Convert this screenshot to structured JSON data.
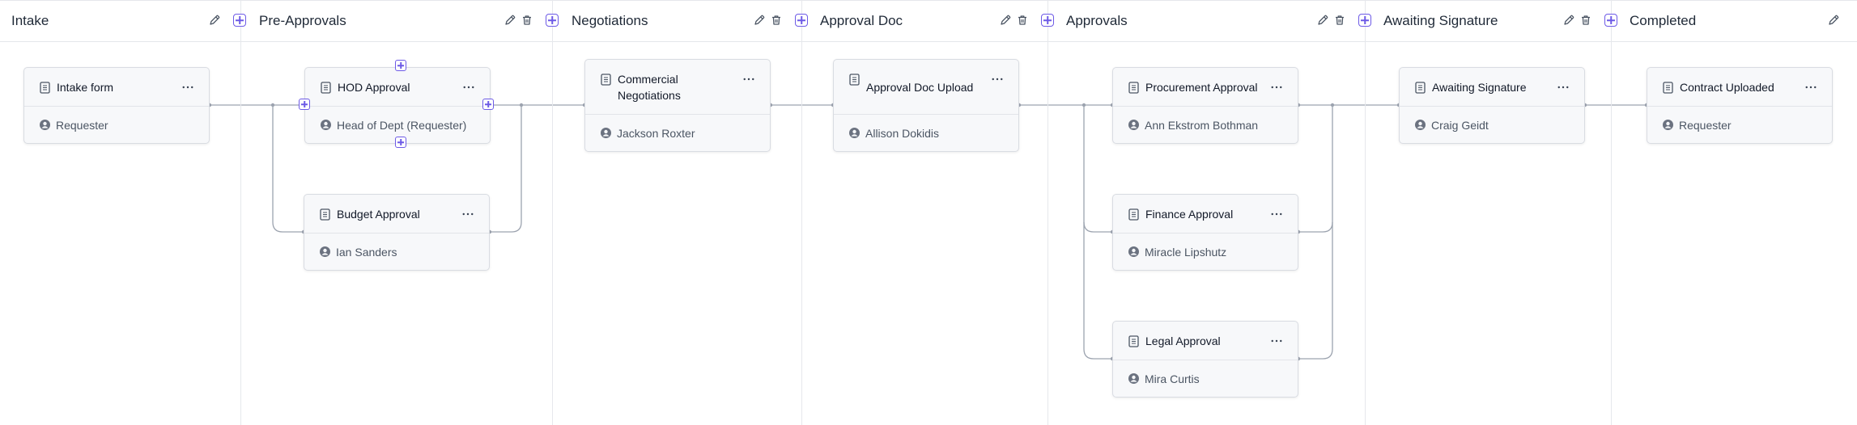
{
  "colors": {
    "accent": "#6d5ae6",
    "edge": "#9ca3af",
    "card_bg": "#f7f8fa",
    "card_border": "#d9dce2",
    "divider": "#e6e8ec"
  },
  "icons": {
    "edit": "pencil-icon",
    "delete": "trash-icon",
    "add": "plus-square-icon",
    "card_type": "document-icon",
    "card_menu": "ellipsis-icon",
    "assignee": "user-circle-icon"
  },
  "columns": [
    {
      "id": "intake",
      "title": "Intake",
      "deletable": false
    },
    {
      "id": "pre-approvals",
      "title": "Pre-Approvals",
      "deletable": true
    },
    {
      "id": "negotiations",
      "title": "Negotiations",
      "deletable": true
    },
    {
      "id": "approval-doc",
      "title": "Approval Doc",
      "deletable": true
    },
    {
      "id": "approvals",
      "title": "Approvals",
      "deletable": true
    },
    {
      "id": "awaiting-signature",
      "title": "Awaiting Signature",
      "deletable": true
    },
    {
      "id": "completed",
      "title": "Completed",
      "deletable": false
    }
  ],
  "cards": [
    {
      "id": "intake-form",
      "column": "intake",
      "title": "Intake form",
      "assignee": "Requester"
    },
    {
      "id": "hod-approval",
      "column": "pre-approvals",
      "title": "HOD Approval",
      "assignee": "Head of Dept (Requester)"
    },
    {
      "id": "budget-approval",
      "column": "pre-approvals",
      "title": "Budget Approval",
      "assignee": "Ian Sanders"
    },
    {
      "id": "commercial-negotiations",
      "column": "negotiations",
      "title": "Commercial Negotiations",
      "assignee": "Jackson Roxter"
    },
    {
      "id": "approval-doc-upload",
      "column": "approval-doc",
      "title": "Approval Doc Upload",
      "assignee": "Allison Dokidis"
    },
    {
      "id": "procurement-approval",
      "column": "approvals",
      "title": "Procurement Approval",
      "assignee": "Ann Ekstrom Bothman"
    },
    {
      "id": "finance-approval",
      "column": "approvals",
      "title": "Finance Approval",
      "assignee": "Miracle Lipshutz"
    },
    {
      "id": "legal-approval",
      "column": "approvals",
      "title": "Legal Approval",
      "assignee": "Mira Curtis"
    },
    {
      "id": "awaiting-signature",
      "column": "awaiting-signature",
      "title": "Awaiting Signature",
      "assignee": "Craig Geidt"
    },
    {
      "id": "contract-uploaded",
      "column": "completed",
      "title": "Contract Uploaded",
      "assignee": "Requester"
    }
  ]
}
